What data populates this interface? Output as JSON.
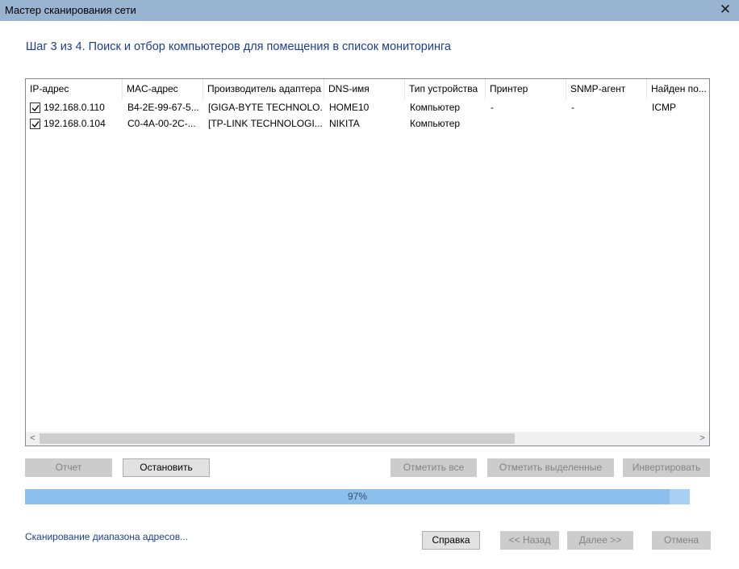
{
  "window": {
    "title": "Мастер сканирования сети",
    "close_glyph": "✕"
  },
  "heading": "Шаг 3 из 4. Поиск и отбор компьютеров для помещения в список мониторинга",
  "table": {
    "columns": [
      "IP-адрес",
      "MAC-адрес",
      "Производитель адаптера",
      "DNS-имя",
      "Тип устройства",
      "Принтер",
      "SNMP-агент",
      "Найден по..."
    ],
    "rows": [
      {
        "checked": true,
        "cells": [
          "192.168.0.110",
          "B4-2E-99-67-5...",
          "[GIGA-BYTE TECHNOLO...",
          "HOME10",
          "Компьютер",
          "-",
          "-",
          "ICMP"
        ]
      },
      {
        "checked": true,
        "cells": [
          "192.168.0.104",
          "C0-4A-00-2C-...",
          "[TP-LINK TECHNOLOGI...",
          "NIKITA",
          "Компьютер",
          "",
          "",
          ""
        ]
      }
    ]
  },
  "scrollbar": {
    "left_arrow": "<",
    "right_arrow": ">"
  },
  "toolbar": {
    "report": "Отчет",
    "stop": "Остановить",
    "select_all": "Отметить все",
    "select_selected": "Отметить выделенные",
    "invert": "Инвертировать"
  },
  "progress": {
    "value_percent": 97,
    "label": "97%"
  },
  "status_link": "Сканирование диапазона адресов...",
  "footer": {
    "help": "Справка",
    "back": "<< Назад",
    "next": "Далее >>",
    "cancel": "Отмена"
  },
  "colors": {
    "titlebar": "#99b4d1",
    "heading_text": "#1e3d8f",
    "progress_fill": "#8bbfee",
    "disabled_button": "#cccccc"
  }
}
